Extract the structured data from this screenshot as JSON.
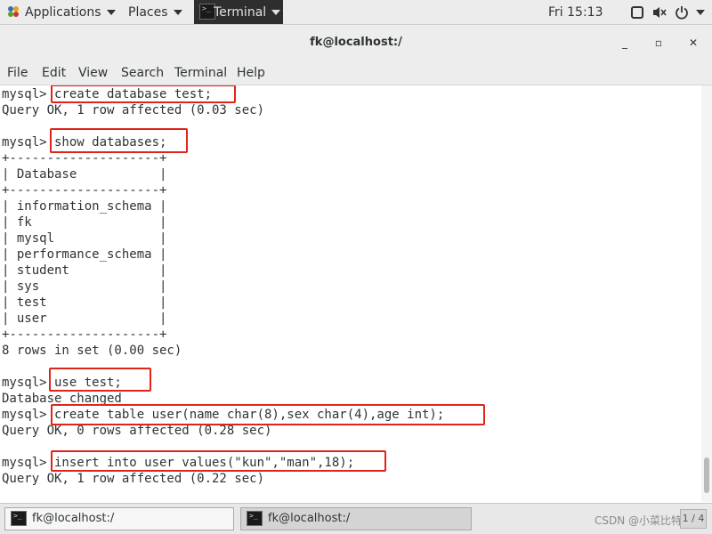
{
  "topbar": {
    "applications": "Applications",
    "places": "Places",
    "terminal": "Terminal",
    "clock": "Fri 15:13",
    "terminal_icon_glyph": ">_",
    "icons": [
      "applications-logo-icon",
      "caret-down-icon",
      "terminal-app-icon",
      "window-switcher-icon",
      "volume-muted-icon",
      "power-icon"
    ]
  },
  "window": {
    "title": "fk@localhost:/",
    "min_glyph": "_",
    "max_glyph": "▫",
    "close_glyph": "✕"
  },
  "menubar": [
    "File",
    "Edit",
    "View",
    "Search",
    "Terminal",
    "Help"
  ],
  "terminal": {
    "lines": [
      "mysql> create database test;",
      "Query OK, 1 row affected (0.03 sec)",
      "",
      "mysql> show databases;",
      "+--------------------+",
      "| Database           |",
      "+--------------------+",
      "| information_schema |",
      "| fk                 |",
      "| mysql              |",
      "| performance_schema |",
      "| student            |",
      "| sys                |",
      "| test               |",
      "| user               |",
      "+--------------------+",
      "8 rows in set (0.00 sec)",
      "",
      "mysql> use test;",
      "Database changed",
      "mysql> create table user(name char(8),sex char(4),age int);",
      "Query OK, 0 rows affected (0.28 sec)",
      "",
      "mysql> insert into user values(\"kun\",\"man\",18);",
      "Query OK, 1 row affected (0.22 sec)"
    ],
    "highlight_color": "#e0241a",
    "highlighted_lines": [
      0,
      3,
      18,
      20,
      23
    ]
  },
  "taskbar": {
    "tasks": [
      {
        "label": "fk@localhost:/",
        "active": false
      },
      {
        "label": "fk@localhost:/",
        "active": true
      }
    ],
    "watermark": "CSDN @小菜比特",
    "workspace": "1 / 4"
  }
}
